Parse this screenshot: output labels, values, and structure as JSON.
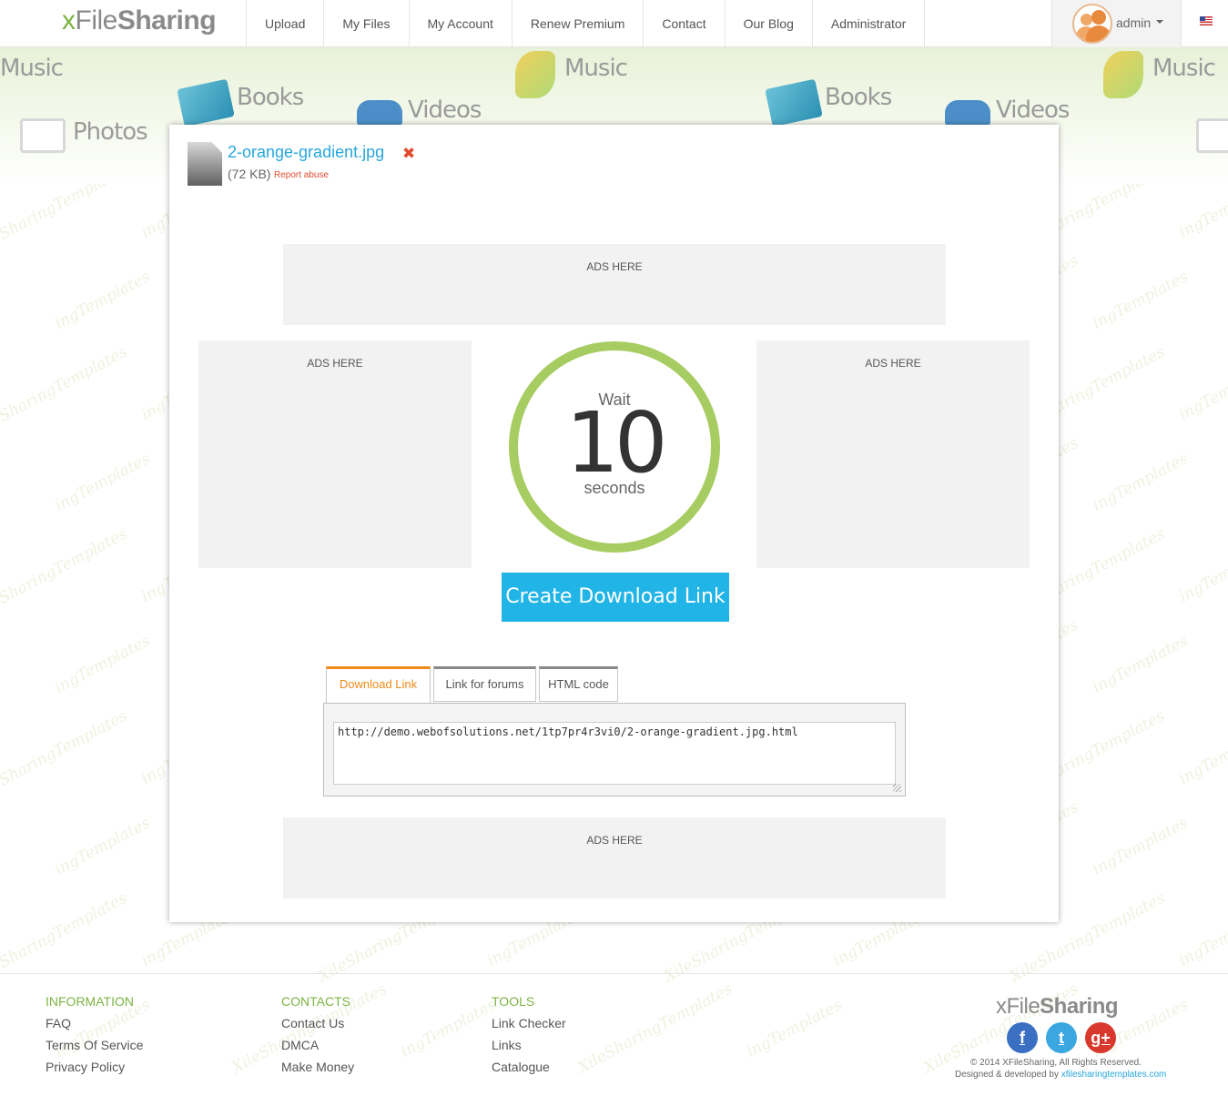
{
  "header": {
    "logo": {
      "x": "x",
      "file": "File",
      "sharing": "Sharing"
    },
    "nav": [
      {
        "label": "Upload"
      },
      {
        "label": "My Files"
      },
      {
        "label": "My Account"
      },
      {
        "label": "Renew Premium"
      },
      {
        "label": "Contact"
      },
      {
        "label": "Our Blog"
      },
      {
        "label": "Administrator"
      }
    ],
    "user": {
      "name": "admin"
    },
    "language_flag": "us-flag-icon"
  },
  "hero": {
    "categories": [
      "Music",
      "Books",
      "Photos",
      "Videos"
    ]
  },
  "file": {
    "name": "2-orange-gradient.jpg",
    "size": "(72 KB)",
    "report_label": "Report abuse"
  },
  "ads": {
    "label": "ADS HERE"
  },
  "countdown": {
    "wait_label": "Wait",
    "value": "10",
    "unit_label": "seconds"
  },
  "download_button": {
    "label": "Create Download Link"
  },
  "link_tabs": {
    "tabs": [
      {
        "label": "Download Link",
        "active": true
      },
      {
        "label": "Link for forums",
        "active": false
      },
      {
        "label": "HTML code",
        "active": false
      }
    ],
    "link_value": "http://demo.webofsolutions.net/1tp7pr4r3vi0/2-orange-gradient.jpg.html"
  },
  "footer": {
    "information": {
      "heading": "INFORMATION",
      "links": [
        "FAQ",
        "Terms Of Service",
        "Privacy Policy"
      ]
    },
    "contacts": {
      "heading": "CONTACTS",
      "links": [
        "Contact Us",
        "DMCA",
        "Make Money"
      ]
    },
    "tools": {
      "heading": "TOOLS",
      "links": [
        "Link Checker",
        "Links",
        "Catalogue"
      ]
    },
    "logo": {
      "file": "xFile",
      "sharing": "Sharing"
    },
    "social": [
      {
        "name": "facebook-icon",
        "glyph": "f",
        "color": "#3b6fc2"
      },
      {
        "name": "twitter-icon",
        "glyph": "t",
        "color": "#3aa7e0"
      },
      {
        "name": "google-plus-icon",
        "glyph": "g+",
        "color": "#d9382c"
      }
    ],
    "copyright": "© 2014 XFileSharing, All Rights Reserved.",
    "credit_prefix": "Designed & developed by",
    "credit_link": "xfilesharingtemplates.com"
  },
  "colors": {
    "brand_green": "#7cb342",
    "accent_blue": "#21b4e6",
    "ring_green": "#a7cc61",
    "active_tab_orange": "#f08a18"
  }
}
